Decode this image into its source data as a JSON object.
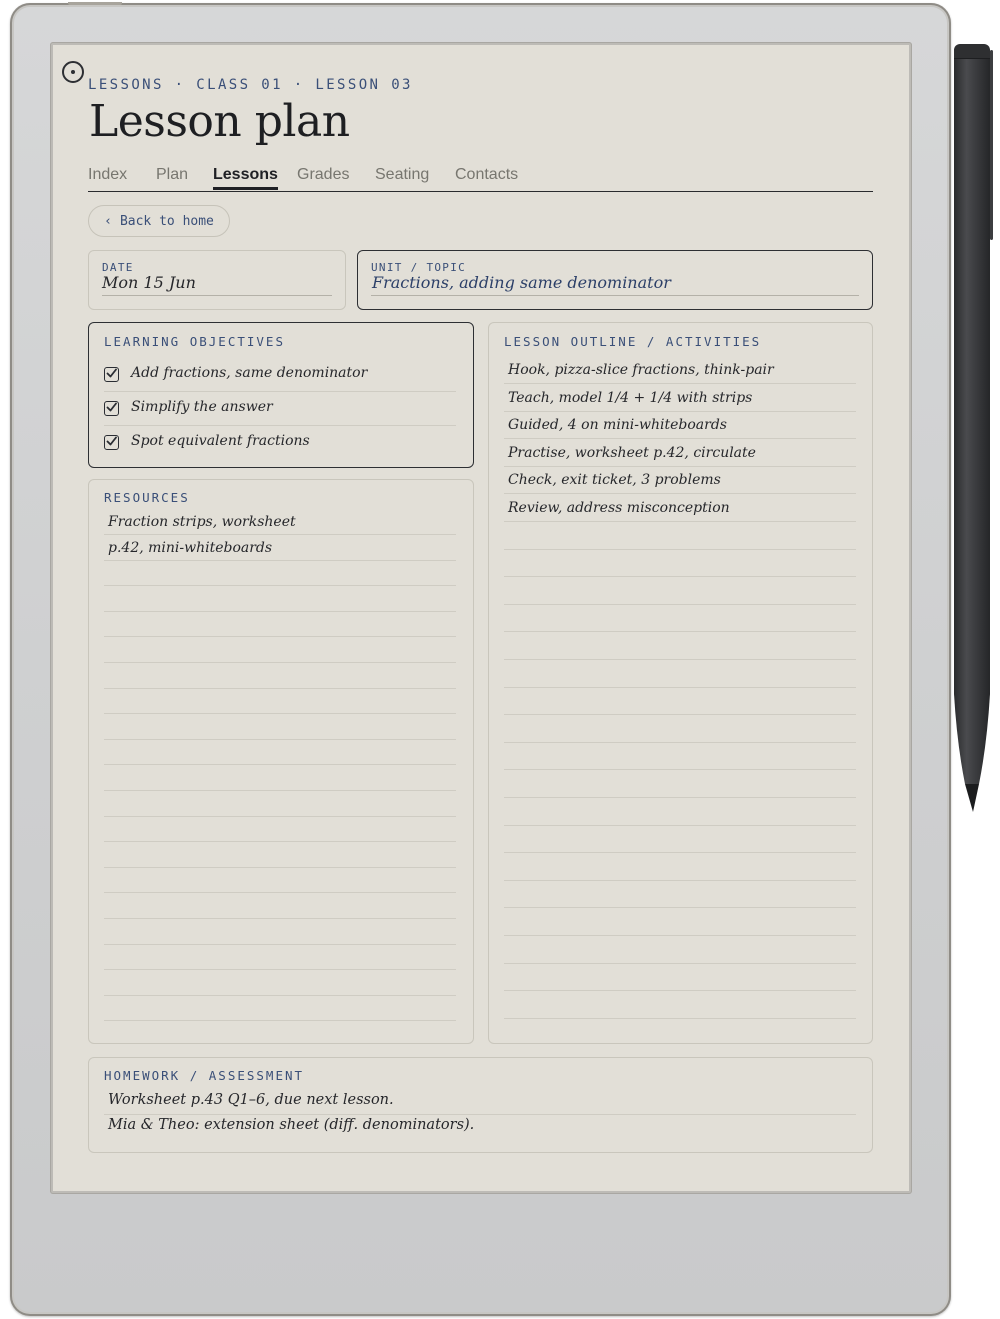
{
  "breadcrumb": "LESSONS · CLASS 01 · LESSON 03",
  "title": "Lesson plan",
  "tabs": [
    {
      "label": "Index",
      "active": false
    },
    {
      "label": "Plan",
      "active": false
    },
    {
      "label": "Lessons",
      "active": true
    },
    {
      "label": "Grades",
      "active": false
    },
    {
      "label": "Seating",
      "active": false
    },
    {
      "label": "Contacts",
      "active": false
    }
  ],
  "back": {
    "icon": "‹",
    "label": "Back to home"
  },
  "date": {
    "label": "DATE",
    "value": "Mon 15 Jun"
  },
  "unit": {
    "label": "UNIT / TOPIC",
    "value": "Fractions, adding same denominator"
  },
  "objectives": {
    "label": "LEARNING OBJECTIVES",
    "items": [
      {
        "text": "Add fractions, same denominator",
        "checked": true
      },
      {
        "text": "Simplify the answer",
        "checked": true
      },
      {
        "text": "Spot equivalent fractions",
        "checked": true
      }
    ]
  },
  "resources": {
    "label": "RESOURCES",
    "lines": [
      "Fraction strips, worksheet",
      "p.42, mini-whiteboards"
    ]
  },
  "outline": {
    "label": "LESSON OUTLINE / ACTIVITIES",
    "items": [
      "Hook, pizza-slice fractions, think-pair",
      "Teach, model 1/4 + 1/4 with strips",
      "Guided, 4 on mini-whiteboards",
      "Practise, worksheet p.42, circulate",
      "Check, exit ticket, 3 problems",
      "Review, address misconception"
    ]
  },
  "homework": {
    "label": "HOMEWORK / ASSESSMENT",
    "lines": [
      "Worksheet p.43 Q1–6, due next lesson.",
      "Mia & Theo: extension sheet (diff. denominators)."
    ]
  },
  "colors": {
    "ink": "#26272b",
    "accent": "#3a4f78",
    "paper": "#e2dfd7"
  }
}
